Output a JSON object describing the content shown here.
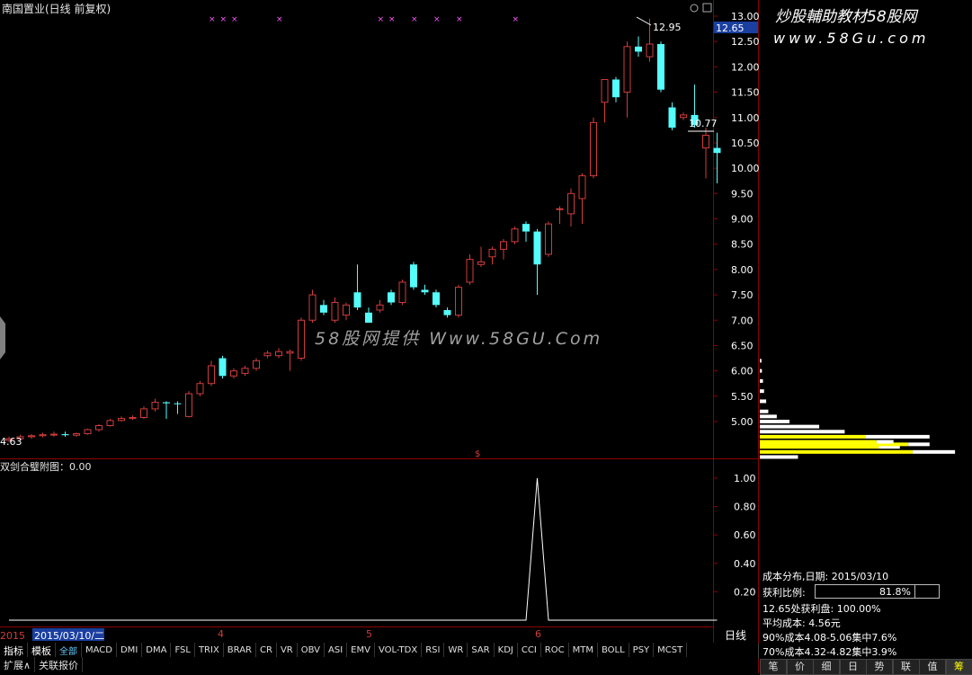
{
  "main": {
    "title": "南国置业(日线 前复权)",
    "price_tag": "12.65",
    "high_annotation": "12.95",
    "low_annotation": "4.63",
    "recent_annotation": "10.77",
    "watermark": "58股网提供 Www.58GU.Com",
    "event_marker": "$"
  },
  "sub": {
    "title": "双剑合璧附图：0.00"
  },
  "timeline": {
    "labels": [
      "2015",
      "2015/03/10/二",
      "4",
      "5",
      "6"
    ]
  },
  "toolbar": {
    "items": [
      "指标",
      "模板",
      "全部",
      "MACD",
      "DMI",
      "DMA",
      "FSL",
      "TRIX",
      "BRAR",
      "CR",
      "VR",
      "OBV",
      "ASI",
      "EMV",
      "VOL-TDX",
      "RSI",
      "WR",
      "SAR",
      "KDJ",
      "CCI",
      "ROC",
      "MTM",
      "BOLL",
      "PSY",
      "MCST"
    ],
    "row2": [
      "扩展∧",
      "关联报价"
    ]
  },
  "right_panel": {
    "brand": "炒股輔助教材58股网",
    "url": "www.58Gu.com",
    "period_label": "日线",
    "plus": "+",
    "minus": "-",
    "zero": "0",
    "cost_dist": "成本分布,日期: 2015/03/10",
    "profit_label": "获利比例:",
    "profit_value": "81.8%",
    "profit_at": "12.65处获利盘: 100.00%",
    "avg_cost": "平均成本: 4.56元",
    "c90": "90%成本4.08-5.06集中7.6%",
    "c70": "70%成本4.32-4.82集中3.9%",
    "tabs": [
      "笔",
      "价",
      "细",
      "日",
      "势",
      "联",
      "值",
      "筹"
    ],
    "cost_profile_colors": {
      "profit": "#ffffff",
      "loss": "#ffff00"
    },
    "cost_profile": [
      {
        "price": 4.3,
        "white": 0.18,
        "yellow": 0
      },
      {
        "price": 4.4,
        "white": 0.2,
        "yellow": 0.72
      },
      {
        "price": 4.5,
        "white": 0.1,
        "yellow": 0.56
      },
      {
        "price": 4.55,
        "white": 0.1,
        "yellow": 0.7
      },
      {
        "price": 4.6,
        "white": 0.08,
        "yellow": 0.55
      },
      {
        "price": 4.7,
        "white": 0.3,
        "yellow": 0.5
      },
      {
        "price": 4.8,
        "white": 0.4,
        "yellow": 0
      },
      {
        "price": 4.9,
        "white": 0.28,
        "yellow": 0
      },
      {
        "price": 5.0,
        "white": 0.14,
        "yellow": 0
      },
      {
        "price": 5.1,
        "white": 0.08,
        "yellow": 0
      },
      {
        "price": 5.2,
        "white": 0.04,
        "yellow": 0
      },
      {
        "price": 5.4,
        "white": 0.03,
        "yellow": 0
      },
      {
        "price": 5.6,
        "white": 0.02,
        "yellow": 0
      },
      {
        "price": 5.8,
        "white": 0.015,
        "yellow": 0
      },
      {
        "price": 6.0,
        "white": 0.01,
        "yellow": 0
      },
      {
        "price": 6.2,
        "white": 0.008,
        "yellow": 0
      }
    ]
  },
  "colors": {
    "up": "#d13c3c",
    "down": "#54fcfc",
    "grid": "#8b0000",
    "marker": "#ff55ff"
  },
  "chart_data": [
    {
      "type": "candlestick",
      "title": "南国置业(日线 前复权)",
      "y_ticks": [
        5.0,
        5.5,
        6.0,
        6.5,
        7.0,
        7.5,
        8.0,
        8.5,
        9.0,
        9.5,
        10.0,
        10.5,
        11.0,
        11.5,
        12.0,
        12.5,
        13.0
      ],
      "y_tick_labels": [
        "5.00",
        "5.50",
        "6.00",
        "6.50",
        "7.00",
        "7.50",
        "8.00",
        "8.50",
        "9.00",
        "9.50",
        "10.00",
        "10.50",
        "11.00",
        "11.50",
        "12.00",
        "12.50",
        "13.00"
      ],
      "ylim": [
        4.0,
        13.1
      ],
      "marker_days": [
        18,
        19,
        20,
        24,
        33,
        34,
        36,
        38,
        40,
        45
      ],
      "candles": [
        {
          "o": 4.63,
          "h": 4.7,
          "l": 4.6,
          "c": 4.66
        },
        {
          "o": 4.66,
          "h": 4.74,
          "l": 4.63,
          "c": 4.7
        },
        {
          "o": 4.7,
          "h": 4.75,
          "l": 4.66,
          "c": 4.72
        },
        {
          "o": 4.72,
          "h": 4.78,
          "l": 4.69,
          "c": 4.74
        },
        {
          "o": 4.74,
          "h": 4.8,
          "l": 4.7,
          "c": 4.75
        },
        {
          "o": 4.75,
          "h": 4.8,
          "l": 4.7,
          "c": 4.73
        },
        {
          "o": 4.73,
          "h": 4.78,
          "l": 4.7,
          "c": 4.76
        },
        {
          "o": 4.76,
          "h": 4.86,
          "l": 4.74,
          "c": 4.84
        },
        {
          "o": 4.84,
          "h": 4.95,
          "l": 4.8,
          "c": 4.92
        },
        {
          "o": 4.92,
          "h": 5.05,
          "l": 4.9,
          "c": 5.02
        },
        {
          "o": 5.02,
          "h": 5.1,
          "l": 5.0,
          "c": 5.06
        },
        {
          "o": 5.06,
          "h": 5.12,
          "l": 5.03,
          "c": 5.08
        },
        {
          "o": 5.08,
          "h": 5.3,
          "l": 5.05,
          "c": 5.25
        },
        {
          "o": 5.25,
          "h": 5.45,
          "l": 5.2,
          "c": 5.38
        },
        {
          "o": 5.38,
          "h": 5.4,
          "l": 5.05,
          "c": 5.36
        },
        {
          "o": 5.36,
          "h": 5.4,
          "l": 5.15,
          "c": 5.35
        },
        {
          "o": 5.1,
          "h": 5.6,
          "l": 5.08,
          "c": 5.55
        },
        {
          "o": 5.55,
          "h": 5.8,
          "l": 5.5,
          "c": 5.75
        },
        {
          "o": 5.75,
          "h": 6.2,
          "l": 5.7,
          "c": 6.1
        },
        {
          "o": 6.25,
          "h": 6.3,
          "l": 5.85,
          "c": 5.9
        },
        {
          "o": 5.9,
          "h": 6.05,
          "l": 5.85,
          "c": 6.0
        },
        {
          "o": 5.95,
          "h": 6.1,
          "l": 5.9,
          "c": 6.05
        },
        {
          "o": 6.05,
          "h": 6.25,
          "l": 6.0,
          "c": 6.2
        },
        {
          "o": 6.3,
          "h": 6.4,
          "l": 6.25,
          "c": 6.35
        },
        {
          "o": 6.3,
          "h": 6.45,
          "l": 6.25,
          "c": 6.38
        },
        {
          "o": 6.35,
          "h": 6.42,
          "l": 6.0,
          "c": 6.38
        },
        {
          "o": 6.25,
          "h": 7.05,
          "l": 6.2,
          "c": 7.0
        },
        {
          "o": 7.0,
          "h": 7.6,
          "l": 6.95,
          "c": 7.5
        },
        {
          "o": 7.3,
          "h": 7.4,
          "l": 7.1,
          "c": 7.15
        },
        {
          "o": 7.0,
          "h": 7.45,
          "l": 6.95,
          "c": 7.35
        },
        {
          "o": 7.1,
          "h": 7.35,
          "l": 7.0,
          "c": 7.3
        },
        {
          "o": 7.55,
          "h": 8.1,
          "l": 7.2,
          "c": 7.25
        },
        {
          "o": 7.15,
          "h": 7.25,
          "l": 6.95,
          "c": 6.95
        },
        {
          "o": 7.2,
          "h": 7.4,
          "l": 7.15,
          "c": 7.3
        },
        {
          "o": 7.55,
          "h": 7.6,
          "l": 7.3,
          "c": 7.35
        },
        {
          "o": 7.35,
          "h": 7.8,
          "l": 7.3,
          "c": 7.75
        },
        {
          "o": 8.1,
          "h": 8.15,
          "l": 7.6,
          "c": 7.65
        },
        {
          "o": 7.6,
          "h": 7.7,
          "l": 7.5,
          "c": 7.55
        },
        {
          "o": 7.55,
          "h": 7.6,
          "l": 7.25,
          "c": 7.3
        },
        {
          "o": 7.2,
          "h": 7.25,
          "l": 7.05,
          "c": 7.1
        },
        {
          "o": 7.1,
          "h": 7.7,
          "l": 7.05,
          "c": 7.65
        },
        {
          "o": 7.75,
          "h": 8.3,
          "l": 7.7,
          "c": 8.2
        },
        {
          "o": 8.1,
          "h": 8.45,
          "l": 8.05,
          "c": 8.15
        },
        {
          "o": 8.25,
          "h": 8.45,
          "l": 8.1,
          "c": 8.4
        },
        {
          "o": 8.4,
          "h": 8.6,
          "l": 8.2,
          "c": 8.55
        },
        {
          "o": 8.55,
          "h": 8.85,
          "l": 8.5,
          "c": 8.8
        },
        {
          "o": 8.9,
          "h": 8.95,
          "l": 8.55,
          "c": 8.75
        },
        {
          "o": 8.75,
          "h": 8.8,
          "l": 7.5,
          "c": 8.1
        },
        {
          "o": 8.3,
          "h": 8.95,
          "l": 8.25,
          "c": 8.9
        },
        {
          "o": 9.2,
          "h": 9.25,
          "l": 8.9,
          "c": 9.2
        },
        {
          "o": 9.1,
          "h": 9.6,
          "l": 8.85,
          "c": 9.5
        },
        {
          "o": 9.4,
          "h": 9.9,
          "l": 8.9,
          "c": 9.85
        },
        {
          "o": 9.85,
          "h": 11.0,
          "l": 9.8,
          "c": 10.9
        },
        {
          "o": 11.3,
          "h": 11.75,
          "l": 10.9,
          "c": 11.75
        },
        {
          "o": 11.75,
          "h": 11.8,
          "l": 11.3,
          "c": 11.4
        },
        {
          "o": 11.5,
          "h": 12.5,
          "l": 11.0,
          "c": 12.4
        },
        {
          "o": 12.4,
          "h": 12.6,
          "l": 12.2,
          "c": 12.3
        },
        {
          "o": 12.2,
          "h": 12.95,
          "l": 12.1,
          "c": 12.45
        },
        {
          "o": 12.45,
          "h": 12.5,
          "l": 11.5,
          "c": 11.55
        },
        {
          "o": 11.2,
          "h": 11.3,
          "l": 10.75,
          "c": 10.8
        },
        {
          "o": 11.0,
          "h": 11.1,
          "l": 10.95,
          "c": 11.05
        },
        {
          "o": 11.05,
          "h": 11.65,
          "l": 10.8,
          "c": 10.85
        },
        {
          "o": 10.4,
          "h": 10.8,
          "l": 9.8,
          "c": 10.65
        },
        {
          "o": 10.4,
          "h": 10.7,
          "l": 9.7,
          "c": 10.3
        }
      ]
    },
    {
      "type": "line",
      "title": "双剑合璧附图：0.00",
      "y_ticks": [
        0.2,
        0.4,
        0.6,
        0.8,
        1.0
      ],
      "y_tick_labels": [
        "0.20",
        "0.40",
        "0.60",
        "0.80",
        "1.00"
      ],
      "ylim": [
        0.0,
        1.05
      ],
      "spike_start_day": 46,
      "values": [
        0,
        0,
        0,
        0,
        0,
        0,
        0,
        0,
        0,
        0,
        0,
        0,
        0,
        0,
        0,
        0,
        0,
        0,
        0,
        0,
        0,
        0,
        0,
        0,
        0,
        0,
        0,
        0,
        0,
        0,
        0,
        0,
        0,
        0,
        0,
        0,
        0,
        0,
        0,
        0,
        0,
        0,
        0,
        0,
        0,
        0,
        0,
        1,
        0,
        0,
        0,
        0,
        0,
        0,
        0,
        0,
        0,
        0,
        0,
        0,
        0,
        0,
        0,
        0
      ]
    }
  ]
}
